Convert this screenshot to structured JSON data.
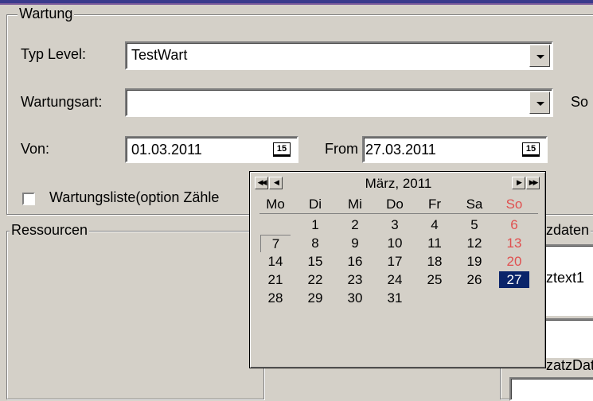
{
  "wartung": {
    "legend": "Wartung",
    "typ_level_label": "Typ Level:",
    "typ_level_value": "TestWart",
    "wartungsart_label": "Wartungsart:",
    "wartungsart_value": "",
    "side_label": "So",
    "von_label": "Von:",
    "von_value": "01.03.2011",
    "from_label": "From",
    "from_value": "27.03.2011",
    "calendar_icon_text": "15",
    "checkbox_label": "Wartungsliste(option Zähle"
  },
  "ressourcen": {
    "legend": "Ressourcen"
  },
  "right_panel": {
    "legend": "zdaten",
    "text1_label": "ztext1",
    "datum_label": "zatzDatu"
  },
  "calendar": {
    "title": "März, 2011",
    "weekdays": [
      "Mo",
      "Di",
      "Mi",
      "Do",
      "Fr",
      "Sa",
      "So"
    ],
    "weeks": [
      [
        "",
        "1",
        "2",
        "3",
        "4",
        "5",
        "6"
      ],
      [
        "7",
        "8",
        "9",
        "10",
        "11",
        "12",
        "13"
      ],
      [
        "14",
        "15",
        "16",
        "17",
        "18",
        "19",
        "20"
      ],
      [
        "21",
        "22",
        "23",
        "24",
        "25",
        "26",
        "27"
      ],
      [
        "28",
        "29",
        "30",
        "31",
        "",
        "",
        ""
      ]
    ],
    "selected_day": "27",
    "today_day": "7",
    "sunday_color": "#e05050",
    "selection_color": "#0a246a"
  }
}
